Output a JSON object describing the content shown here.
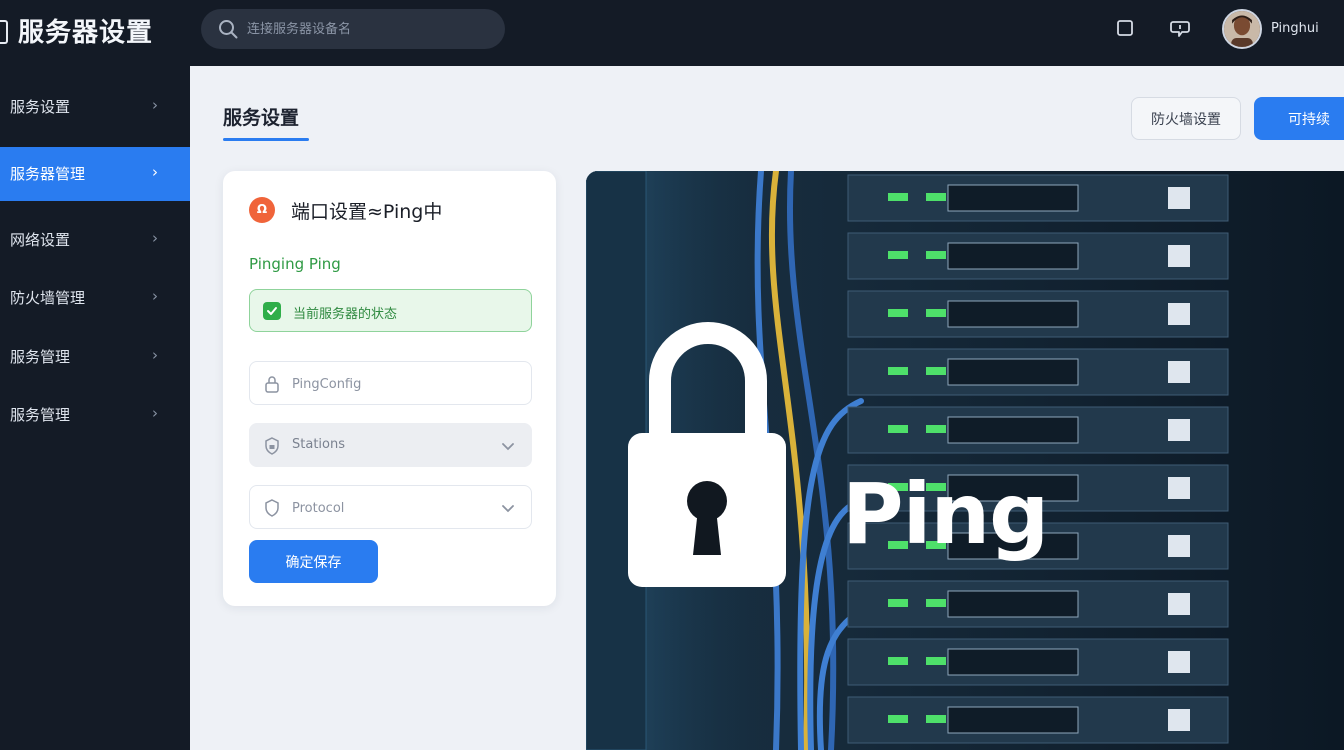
{
  "app": {
    "title": "服务器设置",
    "search_placeholder": "连接服务器设备名",
    "user_name": "Pinghui"
  },
  "topbar_icons": [
    "window-icon",
    "message-icon"
  ],
  "sidebar": {
    "items": [
      {
        "label": "服务设置",
        "active": false
      },
      {
        "label": "服务器管理",
        "active": true
      },
      {
        "label": "网络设置",
        "active": false
      },
      {
        "label": "防火墙管理",
        "active": false
      },
      {
        "label": "服务管理",
        "active": false
      },
      {
        "label": "服务管理",
        "active": false
      }
    ],
    "chevron": "›"
  },
  "main": {
    "title": "服务设置",
    "secondary_button": "防火墙设置",
    "primary_button": "可持续"
  },
  "card": {
    "badge_glyph": "Ω",
    "title": "端口设置≈Ping中",
    "status": "Pinging Ping",
    "alert_text": "当前服务器的状态",
    "fields": [
      {
        "placeholder": "PingConfig",
        "icon": "lock-icon"
      },
      {
        "value": "Stations",
        "icon": "shield-lock-icon"
      },
      {
        "placeholder": "Protocol",
        "icon": "shield-icon"
      }
    ],
    "submit_label": "确定保存"
  },
  "hero": {
    "word": "Ping"
  },
  "colors": {
    "accent": "#2a7cf0",
    "topbar": "#141b26",
    "success": "#2fae4a",
    "badge": "#f0643a"
  }
}
